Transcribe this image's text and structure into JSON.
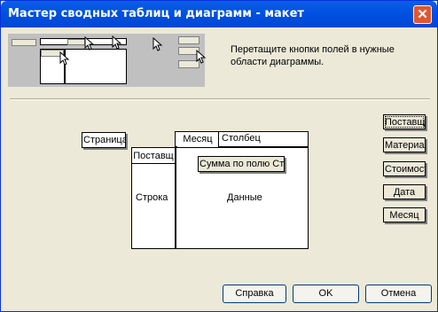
{
  "window": {
    "title": "Мастер сводных таблиц и диаграмм - макет",
    "close_label": "✕"
  },
  "instruction": "Перетащите кнопки полей в нужные области диаграммы.",
  "layout": {
    "page_button": "Страница",
    "column_header": "Месяц",
    "column_label": "Столбец",
    "row_header": "Поставщ",
    "row_label": "Строка",
    "data_header": "Сумма по полю Сто",
    "data_label": "Данные"
  },
  "fields": [
    "Поставщ",
    "Материал",
    "Стоимост",
    "Дата",
    "Месяц"
  ],
  "buttons": {
    "help": "Справка",
    "ok": "OK",
    "cancel": "Отмена"
  }
}
